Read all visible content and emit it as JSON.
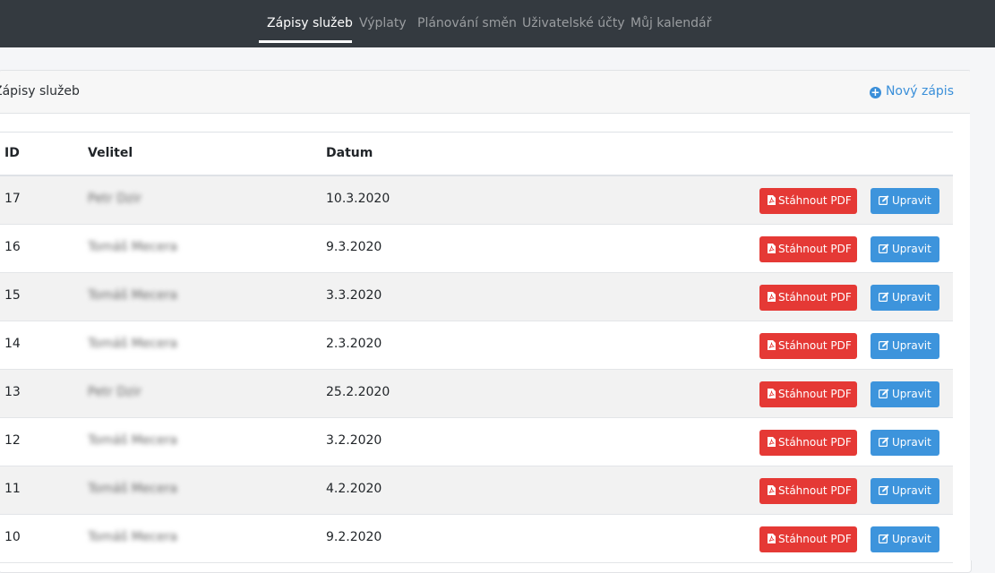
{
  "nav": {
    "items": [
      {
        "label": "Zápisy služeb",
        "active": true
      },
      {
        "label": "Výplaty"
      },
      {
        "label": "Plánování směn"
      },
      {
        "label": "Uživatelské účty"
      },
      {
        "label": "Můj kalendář"
      }
    ]
  },
  "card": {
    "title": "Zápisy služeb",
    "new_label": "Nový zápis"
  },
  "table": {
    "headers": {
      "id": "ID",
      "velitel": "Velitel",
      "datum": "Datum"
    },
    "pdf_label": "Stáhnout PDF",
    "edit_label": "Upravit",
    "rows": [
      {
        "id": "17",
        "velitel": "Petr Dzir",
        "datum": "10.3.2020"
      },
      {
        "id": "16",
        "velitel": "Tomáš Mecera",
        "datum": "9.3.2020"
      },
      {
        "id": "15",
        "velitel": "Tomáš Mecera",
        "datum": "3.3.2020"
      },
      {
        "id": "14",
        "velitel": "Tomáš Mecera",
        "datum": "2.3.2020"
      },
      {
        "id": "13",
        "velitel": "Petr Dzir",
        "datum": "25.2.2020"
      },
      {
        "id": "12",
        "velitel": "Tomáš Mecera",
        "datum": "3.2.2020"
      },
      {
        "id": "11",
        "velitel": "Tomáš Mecera",
        "datum": "4.2.2020"
      },
      {
        "id": "10",
        "velitel": "Tomáš Mecera",
        "datum": "9.2.2020"
      }
    ]
  },
  "colors": {
    "navbar": "#343a40",
    "pdf_button": "#e53935",
    "edit_button": "#3d94dc",
    "link": "#3a8fd9"
  }
}
